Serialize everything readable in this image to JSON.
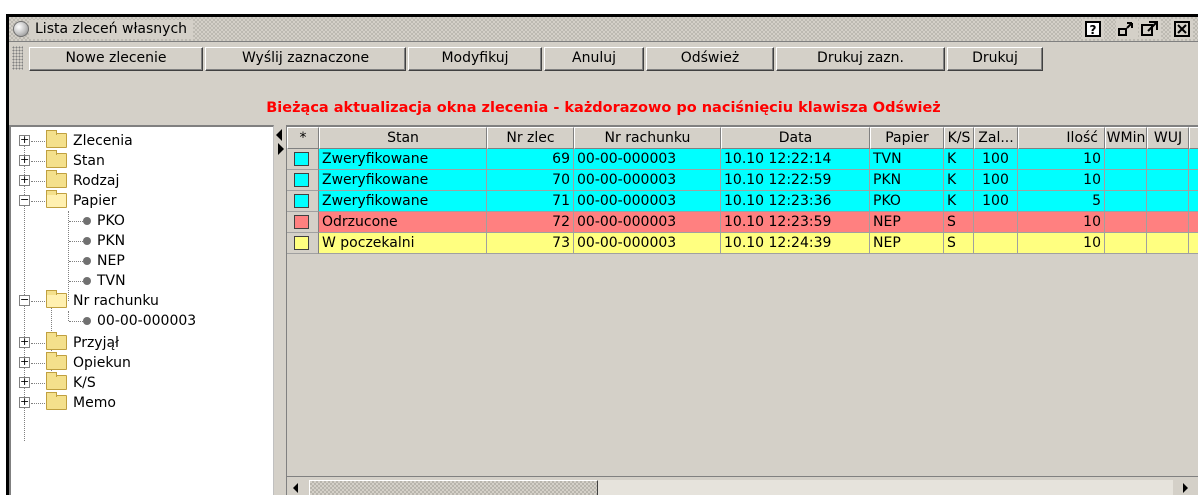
{
  "window": {
    "title": "Lista zleceń własnych",
    "buttons": {
      "help": "?",
      "restore": "▬▪",
      "maximize": "◩",
      "close": "⊠"
    }
  },
  "toolbar": {
    "buttons": [
      "Nowe zlecenie",
      "Wyślij zaznaczone",
      "Modyfikuj",
      "Anuluj",
      "Odśwież",
      "Drukuj zazn.",
      "Drukuj"
    ]
  },
  "banner": {
    "text": "Bieżąca aktualizacja okna zlecenia - każdorazowo po naciśnięciu klawisza Odśwież",
    "color": "#ff0000"
  },
  "tree": {
    "nodes": [
      {
        "label": "Zlecenia",
        "expanded": false
      },
      {
        "label": "Stan",
        "expanded": false
      },
      {
        "label": "Rodzaj",
        "expanded": false
      },
      {
        "label": "Papier",
        "expanded": true,
        "children": [
          "PKO",
          "PKN",
          "NEP",
          "TVN"
        ]
      },
      {
        "label": "Nr rachunku",
        "expanded": true,
        "children": [
          "00-00-000003"
        ]
      },
      {
        "label": "Przyjął",
        "expanded": false
      },
      {
        "label": "Opiekun",
        "expanded": false
      },
      {
        "label": "K/S",
        "expanded": false
      },
      {
        "label": "Memo",
        "expanded": false
      }
    ]
  },
  "grid": {
    "indicator_header": "*",
    "columns": [
      "Stan",
      "Nr zlec",
      "Nr rachunku",
      "Data",
      "Papier",
      "K/S",
      "Zal...",
      "Ilość",
      "WMin",
      "WUJ"
    ],
    "rows": [
      {
        "color": "#00ffff",
        "cells": [
          "Zweryfikowane",
          "69",
          "00-00-000003",
          "10.10 12:22:14",
          "TVN",
          "K",
          "100",
          "10",
          "",
          ""
        ]
      },
      {
        "color": "#00ffff",
        "cells": [
          "Zweryfikowane",
          "70",
          "00-00-000003",
          "10.10 12:22:59",
          "PKN",
          "K",
          "100",
          "10",
          "",
          ""
        ]
      },
      {
        "color": "#00ffff",
        "cells": [
          "Zweryfikowane",
          "71",
          "00-00-000003",
          "10.10 12:23:36",
          "PKO",
          "K",
          "100",
          "5",
          "",
          ""
        ]
      },
      {
        "color": "#ff8080",
        "cells": [
          "Odrzucone",
          "72",
          "00-00-000003",
          "10.10 12:23:59",
          "NEP",
          "S",
          "",
          "10",
          "",
          ""
        ]
      },
      {
        "color": "#ffff80",
        "cells": [
          "W poczekalni",
          "73",
          "00-00-000003",
          "10.10 12:24:39",
          "NEP",
          "S",
          "",
          "10",
          "",
          ""
        ]
      }
    ]
  }
}
